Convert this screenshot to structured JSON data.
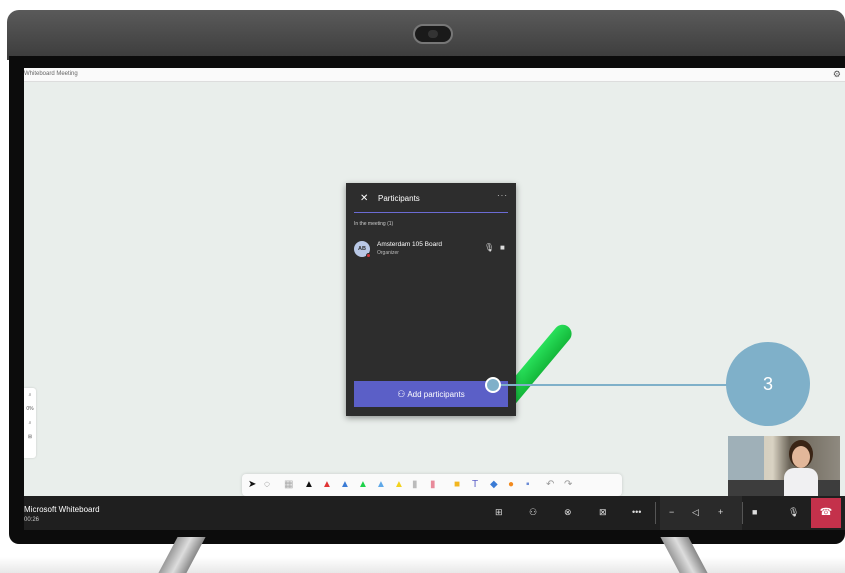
{
  "window": {
    "title": "Whiteboard Meeting"
  },
  "zoom": {
    "value": "0%"
  },
  "participants_panel": {
    "title": "Participants",
    "section_label": "In the meeting (1)",
    "participants": [
      {
        "initials": "AB",
        "name": "Amsterdam 105 Board",
        "role": "Organizer"
      }
    ],
    "add_button_label": "Add participants"
  },
  "callout": {
    "number": "3"
  },
  "call_bar": {
    "app_name": "Microsoft Whiteboard",
    "duration": "00:26"
  },
  "colors": {
    "accent": "#5b5fc7",
    "hangup": "#c4314b",
    "callout": "#7fb0c9",
    "ink_green": "#1ed14a"
  }
}
